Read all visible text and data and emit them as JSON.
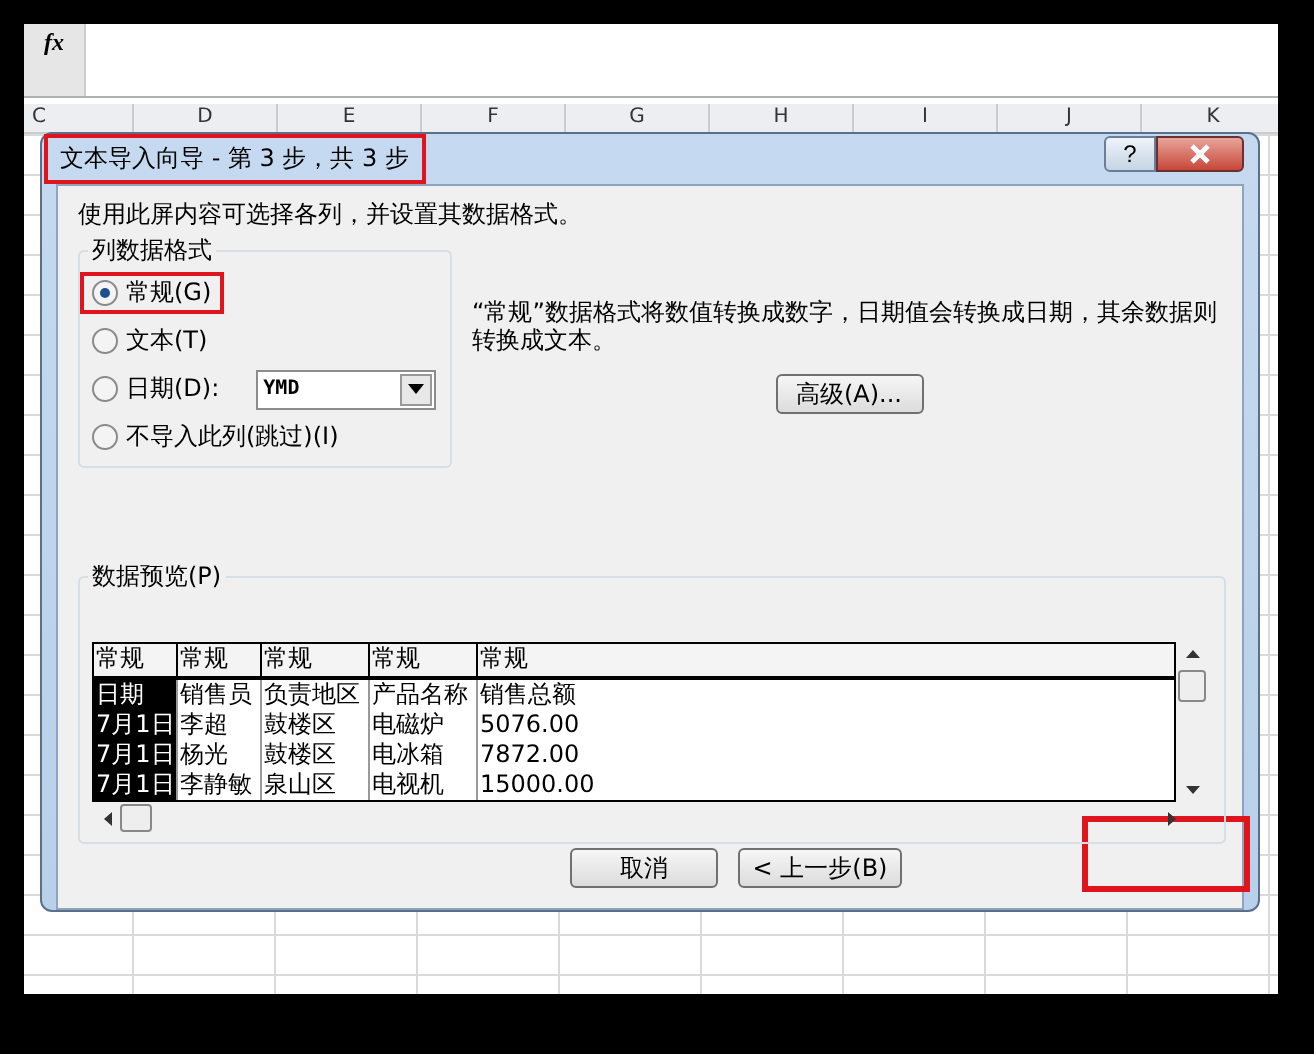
{
  "formula_bar": {
    "fx": "fx"
  },
  "columns": [
    "C",
    "D",
    "E",
    "F",
    "G",
    "H",
    "I",
    "J",
    "K"
  ],
  "dialog": {
    "title": "文本导入向导 - 第 3 步，共 3 步",
    "title_highlighted": true,
    "help": "?",
    "instruction": "使用此屏内容可选择各列，并设置其数据格式。",
    "format_group": {
      "title": "列数据格式",
      "date_format": "YMD",
      "options": [
        {
          "kind": "plain",
          "label": "常规(G)",
          "selected": true,
          "highlighted": true
        },
        {
          "kind": "plain",
          "label": "文本(T)",
          "selected": false,
          "highlighted": false
        },
        {
          "kind": "date",
          "label": "日期(D):",
          "selected": false,
          "highlighted": false
        },
        {
          "kind": "plain",
          "label": "不导入此列(跳过)(I)",
          "selected": false,
          "highlighted": false
        }
      ]
    },
    "description": "“常规”数据格式将数值转换成数字，日期值会转换成日期，其余数据则转换成文本。",
    "advanced_button": "高级(A)...",
    "preview": {
      "title": "数据预览(P)",
      "headers": [
        {
          "label": "常规",
          "selected": true
        },
        {
          "label": "常规",
          "selected": false
        },
        {
          "label": "常规",
          "selected": false
        },
        {
          "label": "常规",
          "selected": false
        },
        {
          "label": "常规",
          "selected": false
        }
      ],
      "rows": [
        [
          "日期",
          "销售员",
          "负责地区",
          "产品名称",
          "销售总额"
        ],
        [
          "7月1日",
          "李超",
          "鼓楼区",
          "电磁炉",
          "5076.00"
        ],
        [
          "7月1日",
          "杨光",
          "鼓楼区",
          "电冰箱",
          "7872.00"
        ],
        [
          "7月1日",
          "李静敏",
          "泉山区",
          "电视机",
          "15000.00"
        ]
      ]
    },
    "buttons": [
      "取消",
      "< 上一步(B)"
    ],
    "finish_highlighted": true
  }
}
